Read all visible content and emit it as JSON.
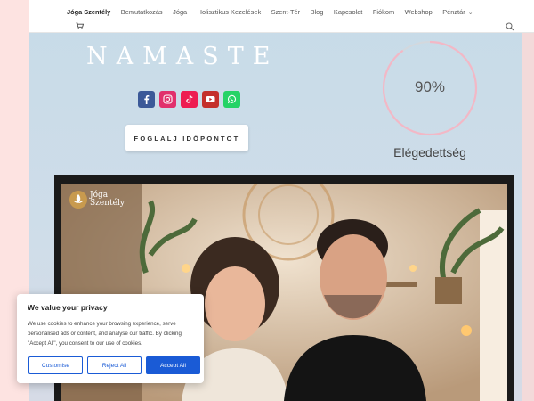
{
  "nav": {
    "items": [
      {
        "label": "Jóga Szentély",
        "active": true
      },
      {
        "label": "Bemutatkozás"
      },
      {
        "label": "Jóga"
      },
      {
        "label": "Holisztikus Kezelések"
      },
      {
        "label": "Szent-Tér"
      },
      {
        "label": "Blog"
      },
      {
        "label": "Kapcsolat"
      },
      {
        "label": "Fiókom"
      },
      {
        "label": "Webshop"
      },
      {
        "label": "Pénztár"
      }
    ],
    "cart_icon": "cart-icon",
    "search_icon": "search-icon"
  },
  "hero": {
    "title": "NAMASTE",
    "title_color": "#ffffff",
    "book_button": "FOGLALJ IDŐPONTOT",
    "socials": [
      {
        "name": "facebook-icon",
        "color": "#3b5998"
      },
      {
        "name": "instagram-icon",
        "color": "#e1306c"
      },
      {
        "name": "tiktok-icon",
        "color": "#ee1d52"
      },
      {
        "name": "youtube-icon",
        "color": "#c4302b"
      },
      {
        "name": "whatsapp-icon",
        "color": "#25d366"
      }
    ]
  },
  "gauge": {
    "value": "90%",
    "percent": 90,
    "label": "Elégedettség",
    "color": "#f2b8c6"
  },
  "video": {
    "logo_line1": "Jóga",
    "logo_line2": "Szentély"
  },
  "cookie": {
    "title": "We value your privacy",
    "text": "We use cookies to enhance your browsing experience, serve personalised ads or content, and analyse our traffic. By clicking \"Accept All\", you consent to our use of cookies.",
    "customise": "Customise",
    "reject": "Reject All",
    "accept": "Accept All",
    "accent": "#1a5bd6"
  }
}
